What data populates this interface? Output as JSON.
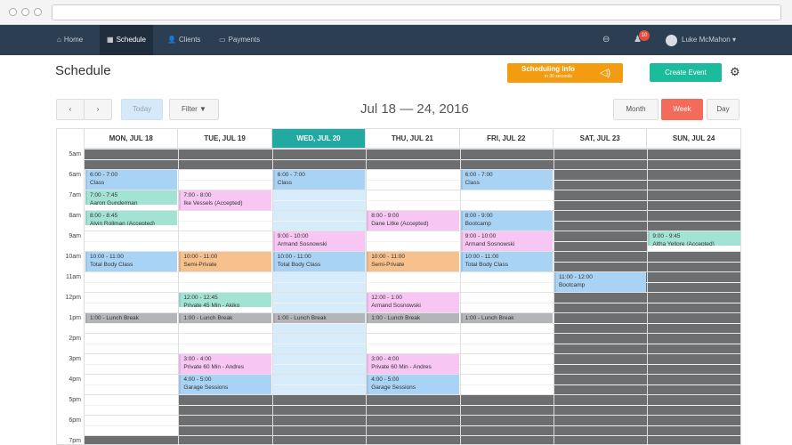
{
  "nav": {
    "items": [
      {
        "label": "Home",
        "icon": "home-icon"
      },
      {
        "label": "Schedule",
        "icon": "calendar-icon"
      },
      {
        "label": "Clients",
        "icon": "user-icon"
      },
      {
        "label": "Payments",
        "icon": "card-icon"
      }
    ],
    "notification_count": "10",
    "user_name": "Luke McMahon"
  },
  "header": {
    "title": "Schedule",
    "info_title": "Scheduling Info",
    "info_subtitle": "in 30 seconds",
    "create_label": "Create Event"
  },
  "toolbar": {
    "prev": "‹",
    "next": "›",
    "today": "Today",
    "filter": "Filter",
    "date_range": "Jul 18 — 24, 2016",
    "views": [
      "Month",
      "Week",
      "Day"
    ],
    "active_view": "Week"
  },
  "calendar": {
    "days": [
      "MON, JUL 18",
      "TUE, JUL 19",
      "WED, JUL 20",
      "THU, JUL 21",
      "FRI, JUL 22",
      "SAT, JUL 23",
      "SUN, JUL 24"
    ],
    "today_index": 2,
    "times": [
      "5am",
      "6am",
      "7am",
      "8am",
      "9am",
      "10am",
      "11am",
      "12pm",
      "1pm",
      "2pm",
      "3pm",
      "4pm",
      "5pm",
      "6pm",
      "7pm"
    ],
    "events": [
      {
        "day": 0,
        "start": 6,
        "end": 7,
        "time": "6:00 - 7:00",
        "title": "Class",
        "color": "blue"
      },
      {
        "day": 0,
        "start": 7,
        "end": 7.75,
        "time": "7:00 - 7:45",
        "title": "Aaron Gunderman",
        "color": "teal"
      },
      {
        "day": 0,
        "start": 8,
        "end": 8.75,
        "time": "8:00 - 8:45",
        "title": "Alvin Rollman (Accepted)",
        "color": "teal"
      },
      {
        "day": 0,
        "start": 10,
        "end": 11,
        "time": "10:00 - 11:00",
        "title": "Total Body Class",
        "color": "blue"
      },
      {
        "day": 0,
        "start": 13,
        "end": 13.5,
        "time": "1:00 - Lunch Break",
        "title": "",
        "color": "gray"
      },
      {
        "day": 1,
        "start": 7,
        "end": 8,
        "time": "7:00 - 8:00",
        "title": "Ike Vessels (Accepted)",
        "color": "pink"
      },
      {
        "day": 1,
        "start": 10,
        "end": 11,
        "time": "10:00 - 11:00",
        "title": "Semi-Private",
        "color": "orange"
      },
      {
        "day": 1,
        "start": 12,
        "end": 12.75,
        "time": "12:00 - 12:45",
        "title": "Private 45 Min - Akiko",
        "color": "teal"
      },
      {
        "day": 1,
        "start": 13,
        "end": 13.5,
        "time": "1:00 - Lunch Break",
        "title": "",
        "color": "gray"
      },
      {
        "day": 1,
        "start": 15,
        "end": 16,
        "time": "3:00 - 4:00",
        "title": "Private 60 Min - Andres",
        "color": "pink"
      },
      {
        "day": 1,
        "start": 16,
        "end": 17,
        "time": "4:00 - 5:00",
        "title": "Garage Sessions",
        "color": "blue"
      },
      {
        "day": 2,
        "start": 6,
        "end": 7,
        "time": "6:00 - 7:00",
        "title": "Class",
        "color": "blue"
      },
      {
        "day": 2,
        "start": 9,
        "end": 10,
        "time": "9:00 - 10:00",
        "title": "Armand Sosnowski",
        "color": "pink"
      },
      {
        "day": 2,
        "start": 10,
        "end": 11,
        "time": "10:00 - 11:00",
        "title": "Total Body Class",
        "color": "blue"
      },
      {
        "day": 2,
        "start": 13,
        "end": 13.5,
        "time": "1:00 - Lunch Break",
        "title": "",
        "color": "gray"
      },
      {
        "day": 3,
        "start": 8,
        "end": 9,
        "time": "8:00 - 9:00",
        "title": "Dane Litke (Accepted)",
        "color": "pink"
      },
      {
        "day": 3,
        "start": 10,
        "end": 11,
        "time": "10:00 - 11:00",
        "title": "Semi-Private",
        "color": "orange"
      },
      {
        "day": 3,
        "start": 12,
        "end": 13,
        "time": "12:00 - 1:00",
        "title": "Armand Sosnowski",
        "color": "pink"
      },
      {
        "day": 3,
        "start": 13,
        "end": 13.5,
        "time": "1:00 - Lunch Break",
        "title": "",
        "color": "gray"
      },
      {
        "day": 3,
        "start": 15,
        "end": 16,
        "time": "3:00 - 4:00",
        "title": "Private 60 Min - Andres",
        "color": "pink"
      },
      {
        "day": 3,
        "start": 16,
        "end": 17,
        "time": "4:00 - 5:00",
        "title": "Garage Sessions",
        "color": "blue"
      },
      {
        "day": 4,
        "start": 6,
        "end": 7,
        "time": "6:00 - 7:00",
        "title": "Class",
        "color": "blue"
      },
      {
        "day": 4,
        "start": 8,
        "end": 9,
        "time": "8:00 - 9:00",
        "title": "Bootcamp",
        "color": "blue"
      },
      {
        "day": 4,
        "start": 9,
        "end": 10,
        "time": "9:00 - 10:00",
        "title": "Armand Sosnowski",
        "color": "pink"
      },
      {
        "day": 4,
        "start": 10,
        "end": 11,
        "time": "10:00 - 11:00",
        "title": "Total Body Class",
        "color": "blue"
      },
      {
        "day": 4,
        "start": 13,
        "end": 13.5,
        "time": "1:00 - Lunch Break",
        "title": "",
        "color": "gray"
      },
      {
        "day": 5,
        "start": 11,
        "end": 12,
        "time": "11:00 - 12:00",
        "title": "Bootcamp",
        "color": "blue"
      },
      {
        "day": 6,
        "start": 9,
        "end": 9.75,
        "time": "9:00 - 9:45",
        "title": "Altha Yellore (Accepted)",
        "color": "teal"
      }
    ]
  }
}
